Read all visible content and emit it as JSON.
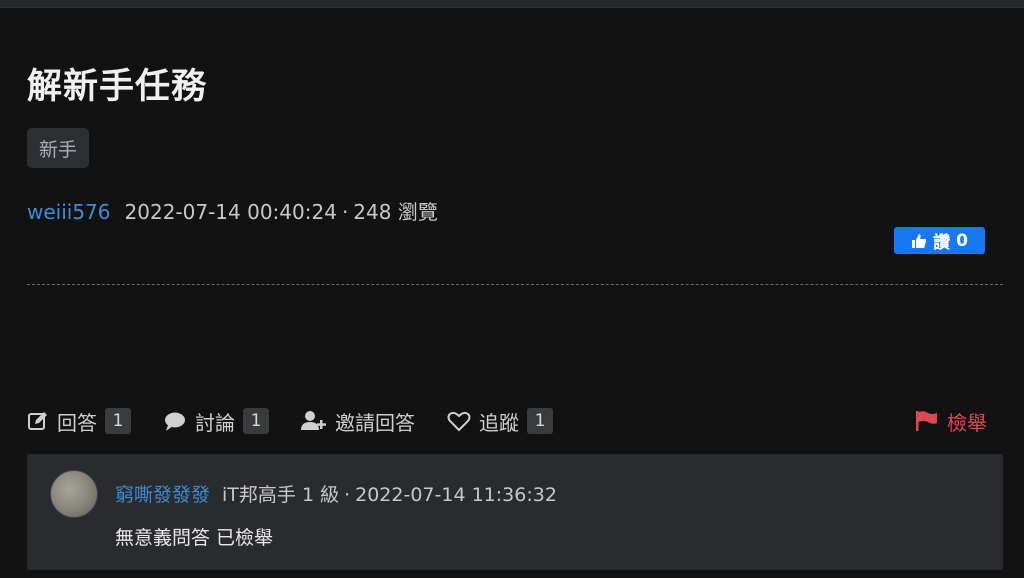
{
  "question": {
    "title": "解新手任務",
    "tag": "新手",
    "author": "weiii576",
    "datetime": "2022-07-14 00:40:24",
    "separator": "·",
    "views": "248 瀏覽",
    "like": {
      "label": "讚",
      "count": "0",
      "color": "#1877f2"
    }
  },
  "actions": {
    "answer": {
      "label": "回答",
      "count": "1",
      "icon": "edit-icon"
    },
    "discuss": {
      "label": "討論",
      "count": "1",
      "icon": "comment-icon"
    },
    "invite": {
      "label": "邀請回答",
      "icon": "user-plus-icon"
    },
    "follow": {
      "label": "追蹤",
      "count": "1",
      "icon": "heart-icon"
    },
    "report": {
      "label": "檢舉",
      "icon": "flag-icon",
      "color": "#e0464e"
    }
  },
  "comment": {
    "author": "窮嘶發發發",
    "rank": "iT邦高手 1 級",
    "separator": "·",
    "datetime": "2022-07-14 11:36:32",
    "body": "無意義問答 已檢舉"
  }
}
